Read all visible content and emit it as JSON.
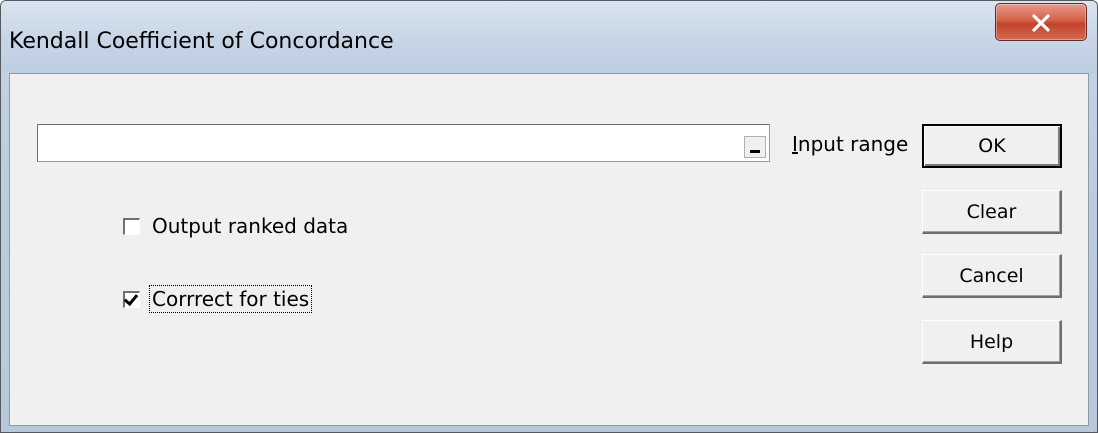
{
  "window": {
    "title": "Kendall Coefficient of Concordance",
    "close_icon": "close-x-icon"
  },
  "input": {
    "value": "",
    "collapse_icon": "collapse-dialog-icon",
    "label_accel": "I",
    "label_rest": "nput range"
  },
  "options": [
    {
      "label": "Output ranked data",
      "checked": false
    },
    {
      "label": "Corrrect for ties",
      "checked": true,
      "focused": true
    }
  ],
  "buttons": {
    "ok": "OK",
    "clear": "Clear",
    "cancel": "Cancel",
    "help": "Help"
  },
  "colors": {
    "titlebar": "#c6d5e6",
    "close_button": "#c2432b",
    "client": "#f0f0f0"
  }
}
